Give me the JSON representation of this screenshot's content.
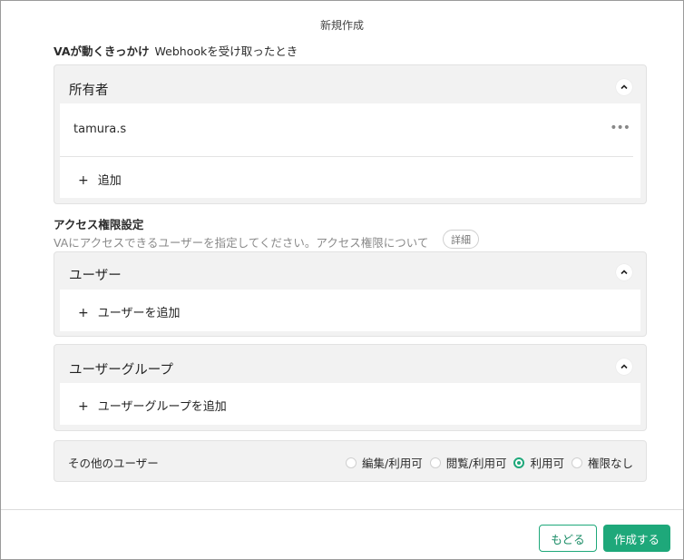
{
  "dialog": {
    "title": "新規作成"
  },
  "trigger": {
    "label": "VAが動くきっかけ",
    "value": "Webhookを受け取ったとき"
  },
  "owner_panel": {
    "heading": "所有者",
    "owners": [
      "tamura.s"
    ],
    "more_label": "•••",
    "add_label": "追加"
  },
  "access": {
    "heading": "アクセス権限設定",
    "description": "VAにアクセスできるユーザーを指定してください。アクセス権限について",
    "detail_label": "詳細"
  },
  "user_panel": {
    "heading": "ユーザー",
    "add_label": "ユーザーを追加"
  },
  "group_panel": {
    "heading": "ユーザーグループ",
    "add_label": "ユーザーグループを追加"
  },
  "others": {
    "label": "その他のユーザー",
    "options": [
      "編集/利用可",
      "閲覧/利用可",
      "利用可",
      "権限なし"
    ],
    "selected": "利用可"
  },
  "footer": {
    "back_label": "もどる",
    "create_label": "作成する"
  },
  "colors": {
    "accent": "#1ea87a",
    "panel_bg": "#f2f2f2"
  }
}
